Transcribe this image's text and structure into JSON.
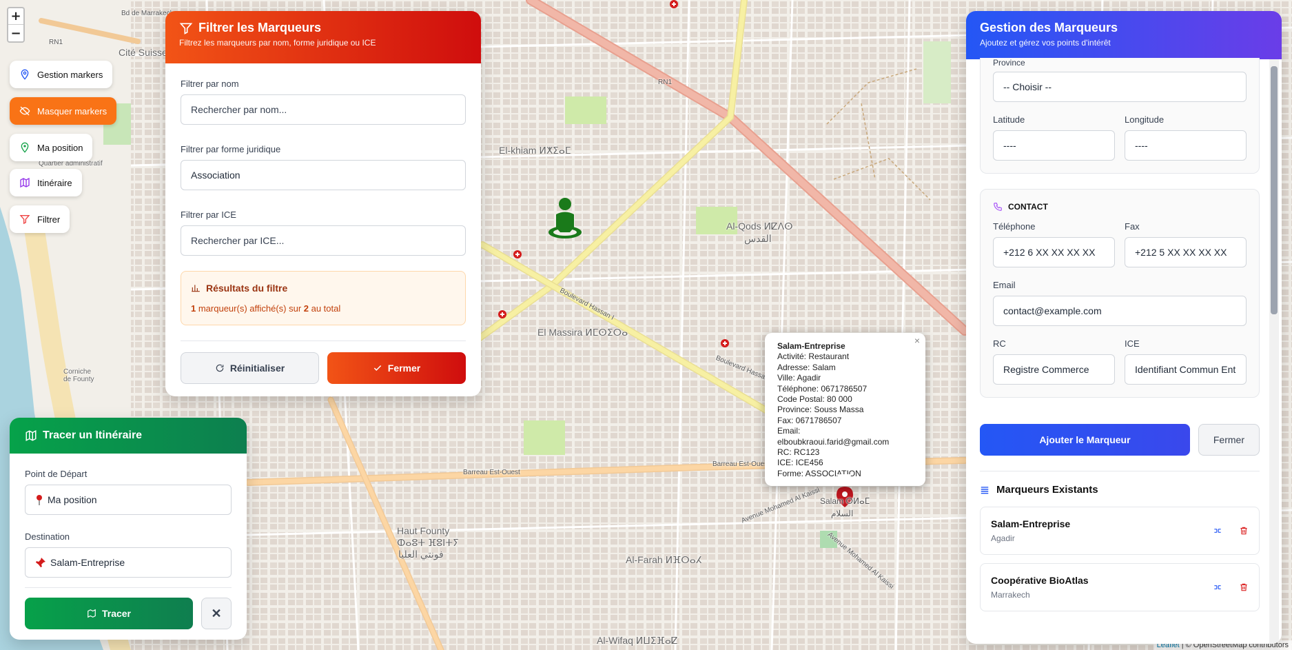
{
  "map": {
    "zoom_in": "+",
    "zoom_out": "−",
    "attribution_leaflet": "Leaflet",
    "attribution_osm": "| © OpenStreetMap contributors",
    "labels": {
      "cite_suisse": "Cité Suisse",
      "el_khiam": "El-khiam ⵍⵅⵉⴰⵎ",
      "al_qods": "Al-Qods ⵍⵇⴷⵙ",
      "al_qods_ar": "القدس",
      "el_massira": "El Massira ⵍⵎⵙⵉⵔⴰ",
      "haut_founty": "Haut Founty",
      "haut_founty_tf": "ⵀⴰⵓⵜ ⴼⵓⵏⵜⵢ",
      "haut_founty_ar": "فونتي العليا",
      "al_farah": "Al-Farah ⵍⴼⵔⴰⵃ",
      "al_wifaq": "Al-Wifaq ⵍⵡⵉⴼⴰⵇ",
      "salam": "Salam ⵙⵍⴰⵎ",
      "salam_ar": "السلام",
      "corniche": "Corniche\nde Founty",
      "barreau": "Barreau Est-Ouest",
      "bd_hassan": "Boulevard Hassan I",
      "rn1": "RN1",
      "av_mohamed": "Avenue Mohamed Al Kaissi",
      "bd_marrakech": "Bd de Marrakech",
      "quartier_admin": "Quartier administratif"
    }
  },
  "side_buttons": [
    {
      "label": "Gestion markers",
      "icon": "map-pin-icon",
      "active": false
    },
    {
      "label": "Masquer markers",
      "icon": "eye-off-icon",
      "active": true
    },
    {
      "label": "Ma position",
      "icon": "location-icon",
      "active": false
    },
    {
      "label": "Itinéraire",
      "icon": "map-icon",
      "active": false
    },
    {
      "label": "Filtrer",
      "icon": "filter-icon",
      "active": false
    }
  ],
  "filter_panel": {
    "title": "Filtrer les Marqueurs",
    "subtitle": "Filtrez les marqueurs par nom, forme juridique ou ICE",
    "name_label": "Filtrer par nom",
    "name_placeholder": "Rechercher par nom...",
    "forme_label": "Filtrer par forme juridique",
    "forme_value": "Association",
    "ice_label": "Filtrer par ICE",
    "ice_placeholder": "Rechercher par ICE...",
    "result_title": "Résultats du filtre",
    "result_shown": "1",
    "result_mid": " marqueur(s) affiché(s) sur ",
    "result_total": "2",
    "result_end": " au total",
    "reset_label": "Réinitialiser",
    "close_label": "Fermer"
  },
  "itinerary_panel": {
    "title": "Tracer un Itinéraire",
    "start_label": "Point de Départ",
    "start_value": "Ma position",
    "dest_label": "Destination",
    "dest_value": "Salam-Entreprise",
    "trace_label": "Tracer",
    "close_symbol": "✕"
  },
  "markers_panel": {
    "title": "Gestion des Marqueurs",
    "subtitle": "Ajoutez et gérez vos points d'intérêt",
    "province_label": "Province",
    "province_value": "-- Choisir --",
    "lat_label": "Latitude",
    "lat_value": "----",
    "lng_label": "Longitude",
    "lng_value": "----",
    "contact_title": "CONTACT",
    "tel_label": "Téléphone",
    "tel_placeholder": "+212 6 XX XX XX XX",
    "fax_label": "Fax",
    "fax_placeholder": "+212 5 XX XX XX XX",
    "email_label": "Email",
    "email_placeholder": "contact@example.com",
    "rc_label": "RC",
    "rc_placeholder": "Registre Commerce",
    "ice_label": "ICE",
    "ice_placeholder": "Identifiant Commun Ent",
    "add_label": "Ajouter le Marqueur",
    "close_label": "Fermer",
    "existing_title": "Marqueurs Existants",
    "items": [
      {
        "name": "Salam-Entreprise",
        "city": "Agadir"
      },
      {
        "name": "Coopérative BioAtlas",
        "city": "Marrakech"
      }
    ]
  },
  "popup": {
    "title": "Salam-Entreprise",
    "lines": [
      "Activité: Restaurant",
      "Adresse: Salam",
      "Ville: Agadir",
      "Téléphone: 0671786507",
      "Code Postal: 80 000",
      "Province: Souss Massa",
      "Fax: 0671786507",
      "Email: elboubkraoui.farid@gmail.com",
      "RC: RC123",
      "ICE: ICE456",
      "Forme: ASSOCIATION"
    ],
    "close": "×"
  },
  "colors": {
    "filter_accent": "#f25416",
    "itinerary_accent": "#06a24a",
    "markers_accent": "#2457f5",
    "active_button": "#f97316",
    "marker_pin": "#c0161f",
    "user_icon": "#1a7a1a"
  }
}
